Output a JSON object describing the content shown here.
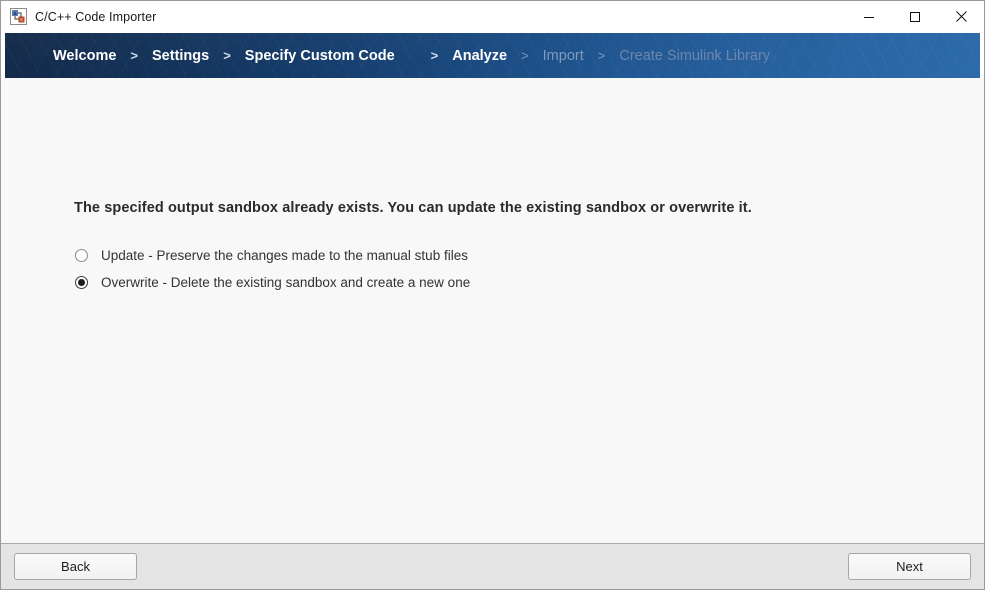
{
  "window": {
    "title": "C/C++ Code Importer",
    "icon": "simulink-importer-icon",
    "controls": {
      "minimize_label": "Minimize",
      "maximize_label": "Maximize",
      "close_label": "Close"
    }
  },
  "wizard": {
    "separator": ">",
    "steps": [
      {
        "label": "Welcome",
        "state": "done"
      },
      {
        "label": "Settings",
        "state": "done"
      },
      {
        "label": "Specify Custom Code",
        "state": "done"
      },
      {
        "label": "Analyze",
        "state": "current"
      },
      {
        "label": "Import",
        "state": "upcoming"
      },
      {
        "label": "Create Simulink Library",
        "state": "upcoming"
      }
    ]
  },
  "main": {
    "heading": "The specifed output sandbox already exists. You can update the existing sandbox or overwrite it.",
    "options": [
      {
        "label": "Update - Preserve the changes made to the manual stub files",
        "selected": false
      },
      {
        "label": "Overwrite - Delete the existing sandbox and create a new one",
        "selected": true
      }
    ]
  },
  "footer": {
    "back_label": "Back",
    "next_label": "Next"
  },
  "colors": {
    "header_dark": "#0b2243",
    "header_light": "#2d6aaa",
    "content_bg": "#f8f8f8",
    "footer_bg": "#e4e4e4",
    "step_active_text": "#ffffff",
    "step_upcoming_text": "#7f99bd"
  }
}
